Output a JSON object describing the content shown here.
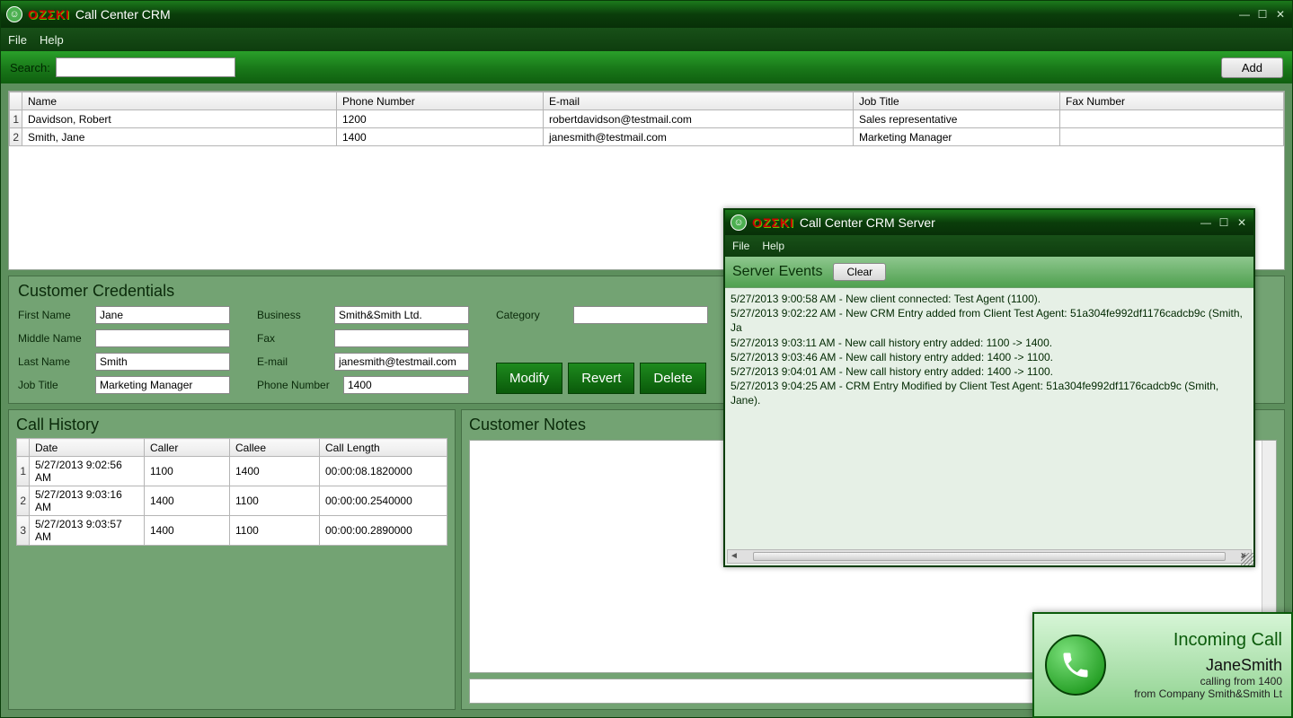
{
  "mainWindow": {
    "brand": "OZΣKI",
    "title": "Call Center CRM",
    "menu": {
      "file": "File",
      "help": "Help"
    },
    "search": {
      "label": "Search:",
      "value": ""
    },
    "addButton": "Add"
  },
  "customerTable": {
    "headers": {
      "name": "Name",
      "phone": "Phone Number",
      "email": "E-mail",
      "jobTitle": "Job Title",
      "fax": "Fax Number"
    },
    "rows": [
      {
        "num": "1",
        "name": "Davidson, Robert",
        "phone": "1200",
        "email": "robertdavidson@testmail.com",
        "jobTitle": "Sales representative",
        "fax": ""
      },
      {
        "num": "2",
        "name": "Smith, Jane",
        "phone": "1400",
        "email": "janesmith@testmail.com",
        "jobTitle": "Marketing Manager",
        "fax": ""
      }
    ]
  },
  "credentials": {
    "title": "Customer Credentials",
    "labels": {
      "firstName": "First Name",
      "middleName": "Middle Name",
      "lastName": "Last Name",
      "jobTitle": "Job Title",
      "business": "Business",
      "fax": "Fax",
      "email": "E-mail",
      "phone": "Phone Number",
      "category": "Category"
    },
    "values": {
      "firstName": "Jane",
      "middleName": "",
      "lastName": "Smith",
      "jobTitle": "Marketing Manager",
      "business": "Smith&Smith Ltd.",
      "fax": "",
      "email": "janesmith@testmail.com",
      "phone": "1400",
      "category": ""
    },
    "buttons": {
      "modify": "Modify",
      "revert": "Revert",
      "delete": "Delete"
    }
  },
  "callHistory": {
    "title": "Call History",
    "headers": {
      "date": "Date",
      "caller": "Caller",
      "callee": "Callee",
      "length": "Call Length"
    },
    "rows": [
      {
        "num": "1",
        "date": "5/27/2013 9:02:56 AM",
        "caller": "1100",
        "callee": "1400",
        "length": "00:00:08.1820000"
      },
      {
        "num": "2",
        "date": "5/27/2013 9:03:16 AM",
        "caller": "1400",
        "callee": "1100",
        "length": "00:00:00.2540000"
      },
      {
        "num": "3",
        "date": "5/27/2013 9:03:57 AM",
        "caller": "1400",
        "callee": "1100",
        "length": "00:00:00.2890000"
      }
    ]
  },
  "notes": {
    "title": "Customer Notes"
  },
  "serverWindow": {
    "brand": "OZΣKI",
    "title": "Call Center CRM Server",
    "menu": {
      "file": "File",
      "help": "Help"
    },
    "sectionTitle": "Server Events",
    "clearButton": "Clear",
    "log": [
      "5/27/2013 9:00:58 AM - New client connected: Test Agent (1100).",
      "5/27/2013 9:02:22 AM - New CRM Entry added from Client Test Agent: 51a304fe992df1176cadcb9c (Smith, Ja",
      "5/27/2013 9:03:11 AM - New call history entry added: 1100 -> 1400.",
      "5/27/2013 9:03:46 AM - New call history entry added: 1400 -> 1100.",
      "5/27/2013 9:04:01 AM - New call history entry added: 1400 -> 1100.",
      "5/27/2013 9:04:25 AM - CRM Entry Modified by Client Test Agent: 51a304fe992df1176cadcb9c (Smith, Jane)."
    ]
  },
  "toast": {
    "title": "Incoming Call",
    "name": "JaneSmith",
    "line1": "calling from 1400",
    "line2": "from Company Smith&Smith Lt"
  }
}
